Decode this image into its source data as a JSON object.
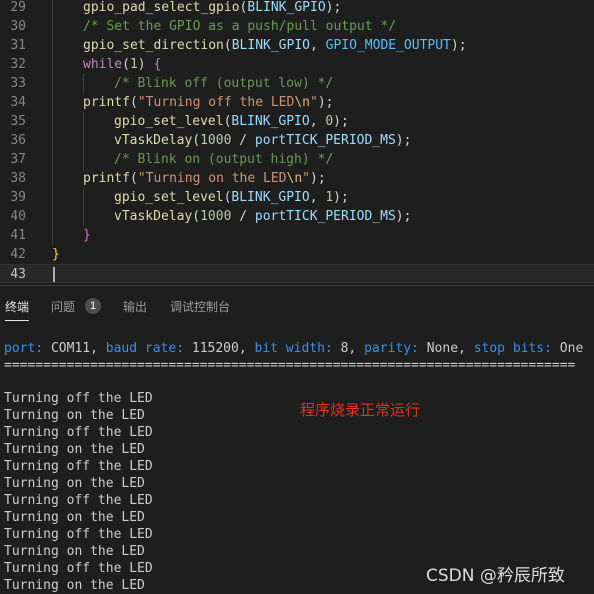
{
  "editor": {
    "lines": [
      {
        "n": "29",
        "parts": [
          [
            "fn",
            "gpio_pad_select_gpio"
          ],
          [
            "",
            "("
          ],
          [
            "macro",
            "BLINK_GPIO"
          ],
          [
            "",
            ");"
          ]
        ],
        "indent": 1
      },
      {
        "n": "30",
        "parts": [
          [
            "cm",
            "/* Set the GPIO as a push/pull output */"
          ]
        ],
        "indent": 1
      },
      {
        "n": "31",
        "parts": [
          [
            "fn",
            "gpio_set_direction"
          ],
          [
            "",
            "("
          ],
          [
            "macro",
            "BLINK_GPIO"
          ],
          [
            "",
            ", "
          ],
          [
            "macro2",
            "GPIO_MODE_OUTPUT"
          ],
          [
            "",
            ");"
          ]
        ],
        "indent": 1
      },
      {
        "n": "32",
        "parts": [
          [
            "kw",
            "while"
          ],
          [
            "",
            "("
          ],
          [
            "num",
            "1"
          ],
          [
            "",
            ") "
          ],
          [
            "brace",
            "{"
          ]
        ],
        "indent": 1
      },
      {
        "n": "33",
        "parts": [
          [
            "cm",
            "/* Blink off (output low) */"
          ]
        ],
        "indent": 2
      },
      {
        "n": "34",
        "parts": [
          [
            "fn",
            "printf"
          ],
          [
            "",
            "("
          ],
          [
            "str",
            "\"Turning off the LED"
          ],
          [
            "esc",
            "\\n"
          ],
          [
            "str",
            "\""
          ],
          [
            "",
            ");"
          ]
        ],
        "indent": 1
      },
      {
        "n": "35",
        "parts": [
          [
            "fn",
            "gpio_set_level"
          ],
          [
            "",
            "("
          ],
          [
            "macro",
            "BLINK_GPIO"
          ],
          [
            "",
            ", "
          ],
          [
            "num",
            "0"
          ],
          [
            "",
            ");"
          ]
        ],
        "indent": 2
      },
      {
        "n": "36",
        "parts": [
          [
            "fn",
            "vTaskDelay"
          ],
          [
            "",
            "("
          ],
          [
            "num",
            "1000"
          ],
          [
            "",
            " / "
          ],
          [
            "macro",
            "portTICK_PERIOD_MS"
          ],
          [
            "",
            ");"
          ]
        ],
        "indent": 2
      },
      {
        "n": "37",
        "parts": [
          [
            "cm",
            "/* Blink on (output high) */"
          ]
        ],
        "indent": 2
      },
      {
        "n": "38",
        "parts": [
          [
            "fn",
            "printf"
          ],
          [
            "",
            "("
          ],
          [
            "str",
            "\"Turning on the LED"
          ],
          [
            "esc",
            "\\n"
          ],
          [
            "str",
            "\""
          ],
          [
            "",
            ");"
          ]
        ],
        "indent": 1
      },
      {
        "n": "39",
        "parts": [
          [
            "fn",
            "gpio_set_level"
          ],
          [
            "",
            "("
          ],
          [
            "macro",
            "BLINK_GPIO"
          ],
          [
            "",
            ", "
          ],
          [
            "num",
            "1"
          ],
          [
            "",
            ");"
          ]
        ],
        "indent": 2
      },
      {
        "n": "40",
        "parts": [
          [
            "fn",
            "vTaskDelay"
          ],
          [
            "",
            "("
          ],
          [
            "num",
            "1000"
          ],
          [
            "",
            " / "
          ],
          [
            "macro",
            "portTICK_PERIOD_MS"
          ],
          [
            "",
            ");"
          ]
        ],
        "indent": 2
      },
      {
        "n": "41",
        "parts": [
          [
            "brace",
            "}"
          ]
        ],
        "indent": 1
      },
      {
        "n": "42",
        "parts": [
          [
            "brace2",
            "}"
          ]
        ],
        "indent": 0
      },
      {
        "n": "43",
        "parts": [],
        "indent": 0
      }
    ]
  },
  "panel": {
    "tabs": {
      "terminal": "终端",
      "problems": "问题",
      "problems_count": "1",
      "output": "输出",
      "debug_console": "调试控制台"
    },
    "serial_info": [
      [
        "tk",
        "port:"
      ],
      [
        "",
        " COM11, "
      ],
      [
        "tk",
        "baud rate:"
      ],
      [
        "",
        " 115200, "
      ],
      [
        "tk",
        "bit width:"
      ],
      [
        "",
        " 8, "
      ],
      [
        "tk",
        "parity:"
      ],
      [
        "",
        " None, "
      ],
      [
        "tk",
        "stop bits:"
      ],
      [
        "",
        " One"
      ]
    ],
    "separator": "=========================================================================",
    "output_lines": [
      "Turning off the LED",
      "Turning on the LED",
      "Turning off the LED",
      "Turning on the LED",
      "Turning off the LED",
      "Turning on the LED",
      "Turning off the LED",
      "Turning on the LED",
      "Turning off the LED",
      "Turning on the LED",
      "Turning off the LED",
      "Turning on the LED"
    ],
    "annotation": "程序烧录正常运行",
    "watermark": "CSDN @矜辰所致"
  }
}
